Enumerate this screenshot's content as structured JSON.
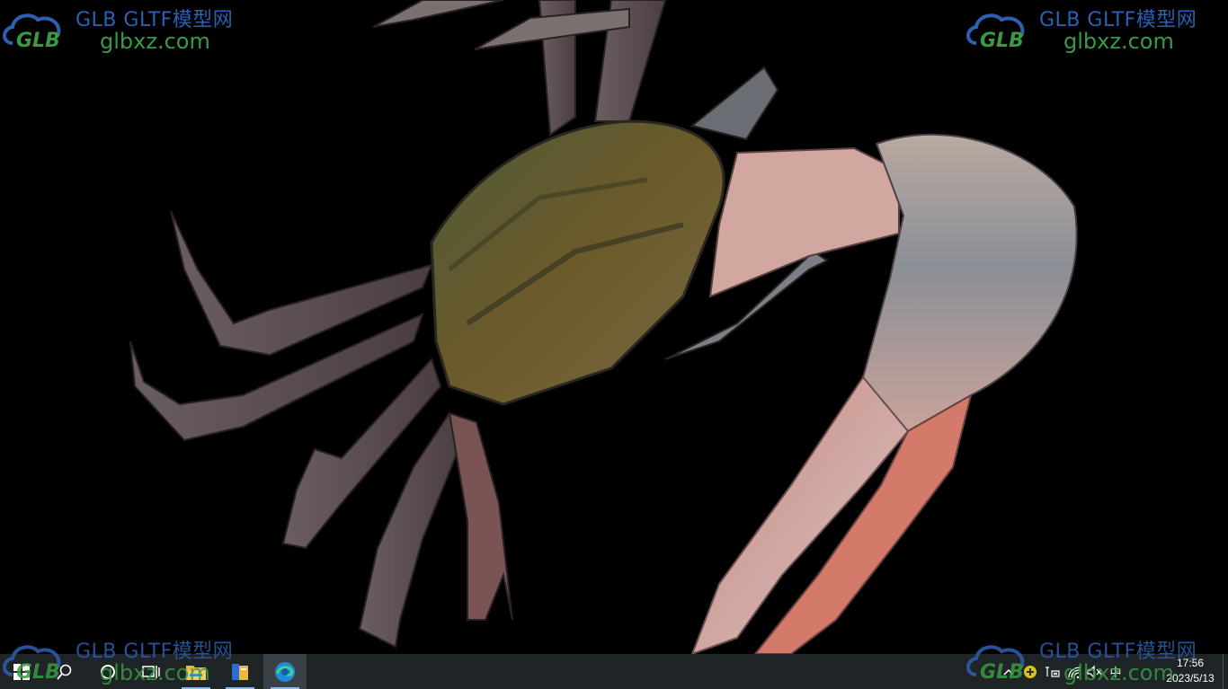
{
  "watermark": {
    "brand": "GLB GLTF模型网",
    "domain": "glbxz.com",
    "logo_text": "GLB"
  },
  "desktop": {
    "background": "#000000",
    "content": "crab-3d-model"
  },
  "taskbar": {
    "background": "#1f2426",
    "items": [
      {
        "name": "start-button",
        "icon": "windows-icon"
      },
      {
        "name": "search-button",
        "icon": "search-icon"
      },
      {
        "name": "cortana-button",
        "icon": "circle-icon"
      },
      {
        "name": "task-view-button",
        "icon": "task-view-icon"
      },
      {
        "name": "file-explorer-button",
        "icon": "folder-icon"
      },
      {
        "name": "app-button",
        "icon": "book-icon"
      },
      {
        "name": "edge-button",
        "icon": "edge-icon",
        "active": true
      }
    ],
    "tray": {
      "chevron": "^",
      "ime_label": "中",
      "time": "17:56",
      "date": "2023/5/13"
    }
  }
}
